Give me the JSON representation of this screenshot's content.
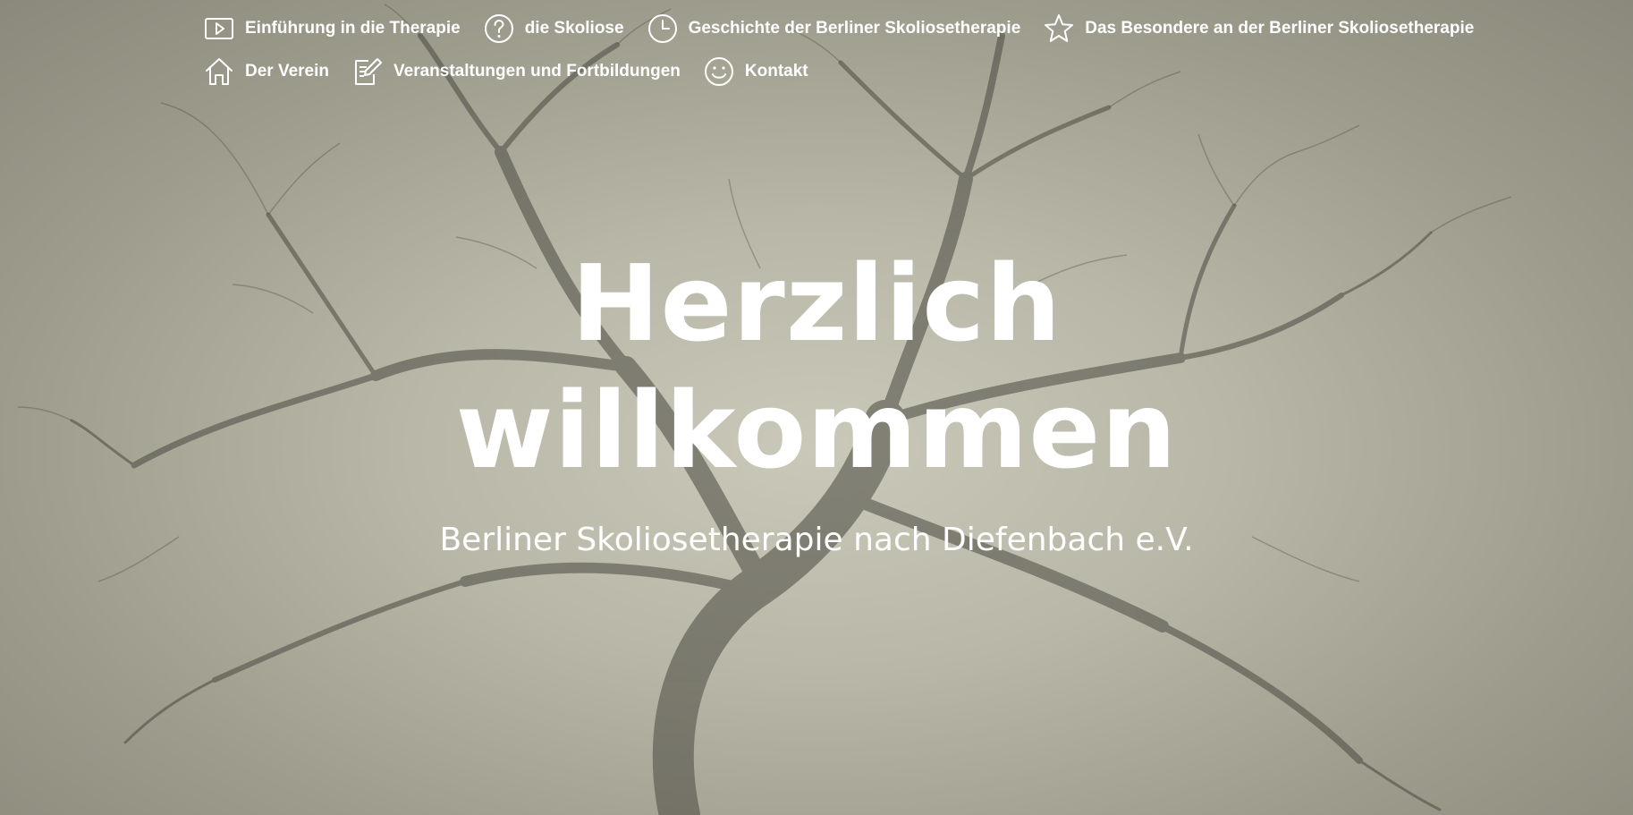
{
  "nav": {
    "items": [
      {
        "label": "Einführung in die Therapie",
        "icon": "play-icon"
      },
      {
        "label": "die Skoliose",
        "icon": "question-icon"
      },
      {
        "label": "Geschichte der Berliner Skoliosetherapie",
        "icon": "clock-icon"
      },
      {
        "label": "Das Besondere an der Berliner Skoliosetherapie",
        "icon": "star-icon"
      },
      {
        "label": "Der Verein",
        "icon": "home-icon"
      },
      {
        "label": "Veranstaltungen und Fortbildungen",
        "icon": "edit-icon"
      },
      {
        "label": "Kontakt",
        "icon": "smiley-icon"
      }
    ]
  },
  "hero": {
    "title_line1": "Herzlich",
    "title_line2": "willkommen",
    "subtitle": "Berliner Skoliosetherapie nach Diefenbach e.V."
  },
  "colors": {
    "text": "#ffffff",
    "background_tone": "#b9b8a8",
    "tree": "#3f3d35"
  }
}
